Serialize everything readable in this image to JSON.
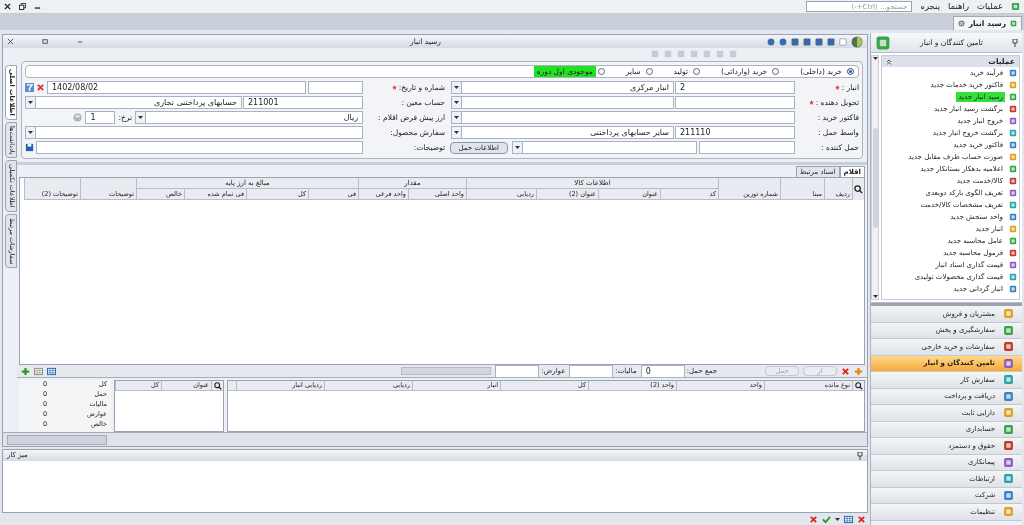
{
  "menu_bar": {
    "items": [
      "عملیات",
      "راهنما",
      "پنجره"
    ],
    "search": {
      "placeholder": "جستجو... (Ctrl+-)"
    }
  },
  "tabs": [
    {
      "label": "رسید انبار",
      "selected": true
    }
  ],
  "document": {
    "title": "رسید انبار",
    "side_tabs": [
      {
        "label": "اطلاعات اصلی",
        "selected": true
      },
      {
        "label": "یادداشت‌ها",
        "selected": false
      },
      {
        "label": "اطلاعات تکمیلی",
        "selected": false
      },
      {
        "label": "سفارشات مرتبط",
        "selected": false
      }
    ],
    "receipt_types": [
      {
        "label": "خرید (داخلی)",
        "selected": true,
        "highlighted": false
      },
      {
        "label": "خرید (وارداتی)",
        "selected": false,
        "highlighted": false
      },
      {
        "label": "تولید",
        "selected": false,
        "highlighted": false
      },
      {
        "label": "سایر",
        "selected": false,
        "highlighted": false
      },
      {
        "label": "موجودی اول دوره",
        "selected": false,
        "highlighted": true
      }
    ],
    "right_fields": [
      {
        "kind": "pair",
        "label": "انبار :",
        "required": true,
        "code": "2",
        "value": "انبار مرکزی"
      },
      {
        "kind": "pair",
        "label": "تحویل دهنده :",
        "required": true
      },
      {
        "kind": "single",
        "label": "فاکتور خرید :",
        "required": false
      },
      {
        "kind": "pair",
        "label": "واسط حمل :",
        "required": false,
        "code": "211110",
        "value": "سایر حسابهای پرداختنی"
      },
      {
        "kind": "pair_button",
        "label": "حمل کننده :",
        "required": false,
        "button": "اطلاعات حمل"
      }
    ],
    "left_fields": [
      {
        "kind": "date",
        "label": "شماره و تاریخ:",
        "required": true,
        "value": "1402/08/02"
      },
      {
        "kind": "pair",
        "label": "حساب معین :",
        "required": false,
        "code": "211001",
        "value": "حسابهای پرداختنی تجاری"
      },
      {
        "kind": "currency",
        "label": "ارز پیش فرض اقلام :",
        "required": false,
        "value": "ریال",
        "rate_label": "نرخ:",
        "rate": "1"
      },
      {
        "kind": "single",
        "label": "سفارش محصول:",
        "required": false
      },
      {
        "kind": "note",
        "label": "توضیحات:",
        "required": false
      }
    ],
    "grid_tabs": [
      {
        "label": "اقلام",
        "selected": true
      },
      {
        "label": "اسناد مرتبط",
        "selected": false
      }
    ],
    "columns": [
      {
        "label": "ردیف"
      },
      {
        "label": "مبنا"
      },
      {
        "label": "شماره توزین"
      },
      {
        "label": "اطلاعات کالا",
        "children": [
          {
            "label": "کد"
          },
          {
            "label": "عنوان"
          },
          {
            "label": "عنوان (2)"
          },
          {
            "label": "ردیابی"
          }
        ]
      },
      {
        "label": "مقدار",
        "children": [
          {
            "label": "واحد اصلی"
          },
          {
            "label": "واحد فرعی"
          }
        ]
      },
      {
        "label": "مبالغ به ارز پایه",
        "children": [
          {
            "label": "فی"
          },
          {
            "label": "کل"
          },
          {
            "label": "فی تمام شده"
          },
          {
            "label": "خالص"
          }
        ]
      },
      {
        "label": "توضیحات"
      },
      {
        "label": "توضیحات (2)"
      }
    ],
    "grid_footer": {
      "buttons": [
        {
          "label": "از",
          "disabled": true
        },
        {
          "label": "حمل",
          "disabled": true
        }
      ],
      "totals": [
        {
          "label": "جمع حمل:",
          "value": "0"
        },
        {
          "label": "مالیات:"
        },
        {
          "label": "عوارض:"
        }
      ]
    },
    "stock_columns": [
      "نوع مانده",
      "واحد",
      "واحد (2)",
      "کل",
      "انبار",
      "ردیابی",
      "ردیابی انبار"
    ],
    "summary_columns": [
      "عنوان",
      "کل"
    ],
    "summary": [
      {
        "label": "کل",
        "value": "0"
      },
      {
        "label": "حمل",
        "value": "0"
      },
      {
        "label": "مالیات",
        "value": "0"
      },
      {
        "label": "عوارض",
        "value": "0"
      },
      {
        "label": "خالص",
        "value": "0"
      }
    ]
  },
  "desk": {
    "title": "میز کار"
  },
  "side_panel": {
    "title": "تامین کنندگان و انبار",
    "section": "عملیات",
    "operations": [
      {
        "label": "فرآیند خرید",
        "highlighted": false
      },
      {
        "label": "فاکتور خرید خدمات جدید",
        "highlighted": false
      },
      {
        "label": "رسید انبار جدید",
        "highlighted": true
      },
      {
        "label": "برگشت رسید انبار جدید",
        "highlighted": false
      },
      {
        "label": "خروج انبار جدید",
        "highlighted": false
      },
      {
        "label": "برگشت خروج انبار جدید",
        "highlighted": false
      },
      {
        "label": "فاکتور خرید جدید",
        "highlighted": false
      },
      {
        "label": "صورت حساب طرف مقابل جدید",
        "highlighted": false
      },
      {
        "label": "اعلامیه بدهکار بستانکار جدید",
        "highlighted": false
      },
      {
        "label": "کالا/خدمت جدید",
        "highlighted": false
      },
      {
        "label": "تعریف الگوی بارکد دوبعدی",
        "highlighted": false
      },
      {
        "label": "تعریف مشخصات کالا/خدمت",
        "highlighted": false
      },
      {
        "label": "واحد سنجش جدید",
        "highlighted": false
      },
      {
        "label": "انبار جدید",
        "highlighted": false
      },
      {
        "label": "عامل محاسبه جدید",
        "highlighted": false
      },
      {
        "label": "فرمول محاسبه جدید",
        "highlighted": false
      },
      {
        "label": "قیمت گذاری اسناد انبار",
        "highlighted": false
      },
      {
        "label": "قیمت گذاری محصولات تولیدی",
        "highlighted": false
      },
      {
        "label": "انبار گردانی جدید",
        "highlighted": false
      }
    ],
    "modules": [
      {
        "label": "مشتریان و فروش",
        "selected": false
      },
      {
        "label": "سفارشگیری و پخش",
        "selected": false
      },
      {
        "label": "سفارشات و خرید خارجی",
        "selected": false
      },
      {
        "label": "تامین کنندگان و انبار",
        "selected": true
      },
      {
        "label": "سفارش کار",
        "selected": false
      },
      {
        "label": "دریافت و پرداخت",
        "selected": false
      },
      {
        "label": "دارایی ثابت",
        "selected": false
      },
      {
        "label": "حسابداری",
        "selected": false
      },
      {
        "label": "حقوق و دستمزد",
        "selected": false
      },
      {
        "label": "پیمانکاری",
        "selected": false
      },
      {
        "label": "ارتباطات",
        "selected": false
      },
      {
        "label": "شرکت",
        "selected": false
      },
      {
        "label": "تنظیمات",
        "selected": false
      }
    ]
  }
}
